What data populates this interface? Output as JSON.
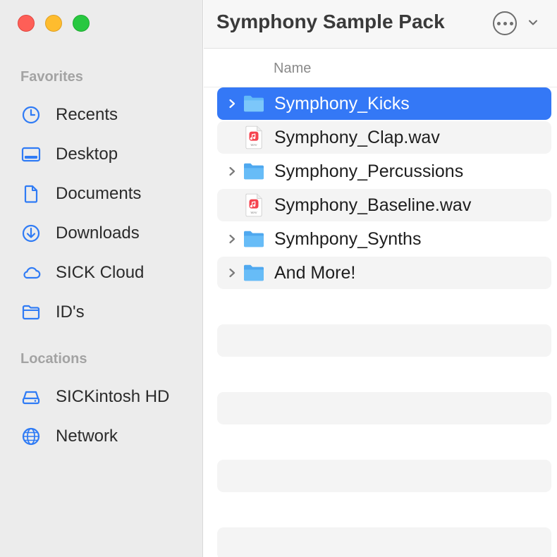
{
  "window": {
    "title": "Symphony Sample Pack"
  },
  "sidebar": {
    "favorites_label": "Favorites",
    "favorites": [
      {
        "label": "Recents",
        "icon": "clock-icon"
      },
      {
        "label": "Desktop",
        "icon": "desktop-icon"
      },
      {
        "label": "Documents",
        "icon": "document-icon"
      },
      {
        "label": "Downloads",
        "icon": "download-icon"
      },
      {
        "label": "SICK Cloud",
        "icon": "cloud-icon"
      },
      {
        "label": "ID's",
        "icon": "folder-icon"
      }
    ],
    "locations_label": "Locations",
    "locations": [
      {
        "label": "SICKintosh HD",
        "icon": "harddrive-icon"
      },
      {
        "label": "Network",
        "icon": "globe-icon"
      }
    ]
  },
  "list": {
    "column_header": "Name",
    "items": [
      {
        "name": "Symphony_Kicks",
        "type": "folder",
        "expandable": true,
        "selected": true
      },
      {
        "name": "Symphony_Clap.wav",
        "type": "wav",
        "expandable": false,
        "selected": false
      },
      {
        "name": "Symphony_Percussions",
        "type": "folder",
        "expandable": true,
        "selected": false
      },
      {
        "name": "Symphony_Baseline.wav",
        "type": "wav",
        "expandable": false,
        "selected": false
      },
      {
        "name": "Symhpony_Synths",
        "type": "folder",
        "expandable": true,
        "selected": false
      },
      {
        "name": "And More!",
        "type": "folder",
        "expandable": true,
        "selected": false
      }
    ],
    "wav_icon_caption": "WAV"
  },
  "colors": {
    "accent": "#3478f6",
    "sidebar_icon": "#2f7bf5",
    "folder": "#5cb6f7"
  }
}
